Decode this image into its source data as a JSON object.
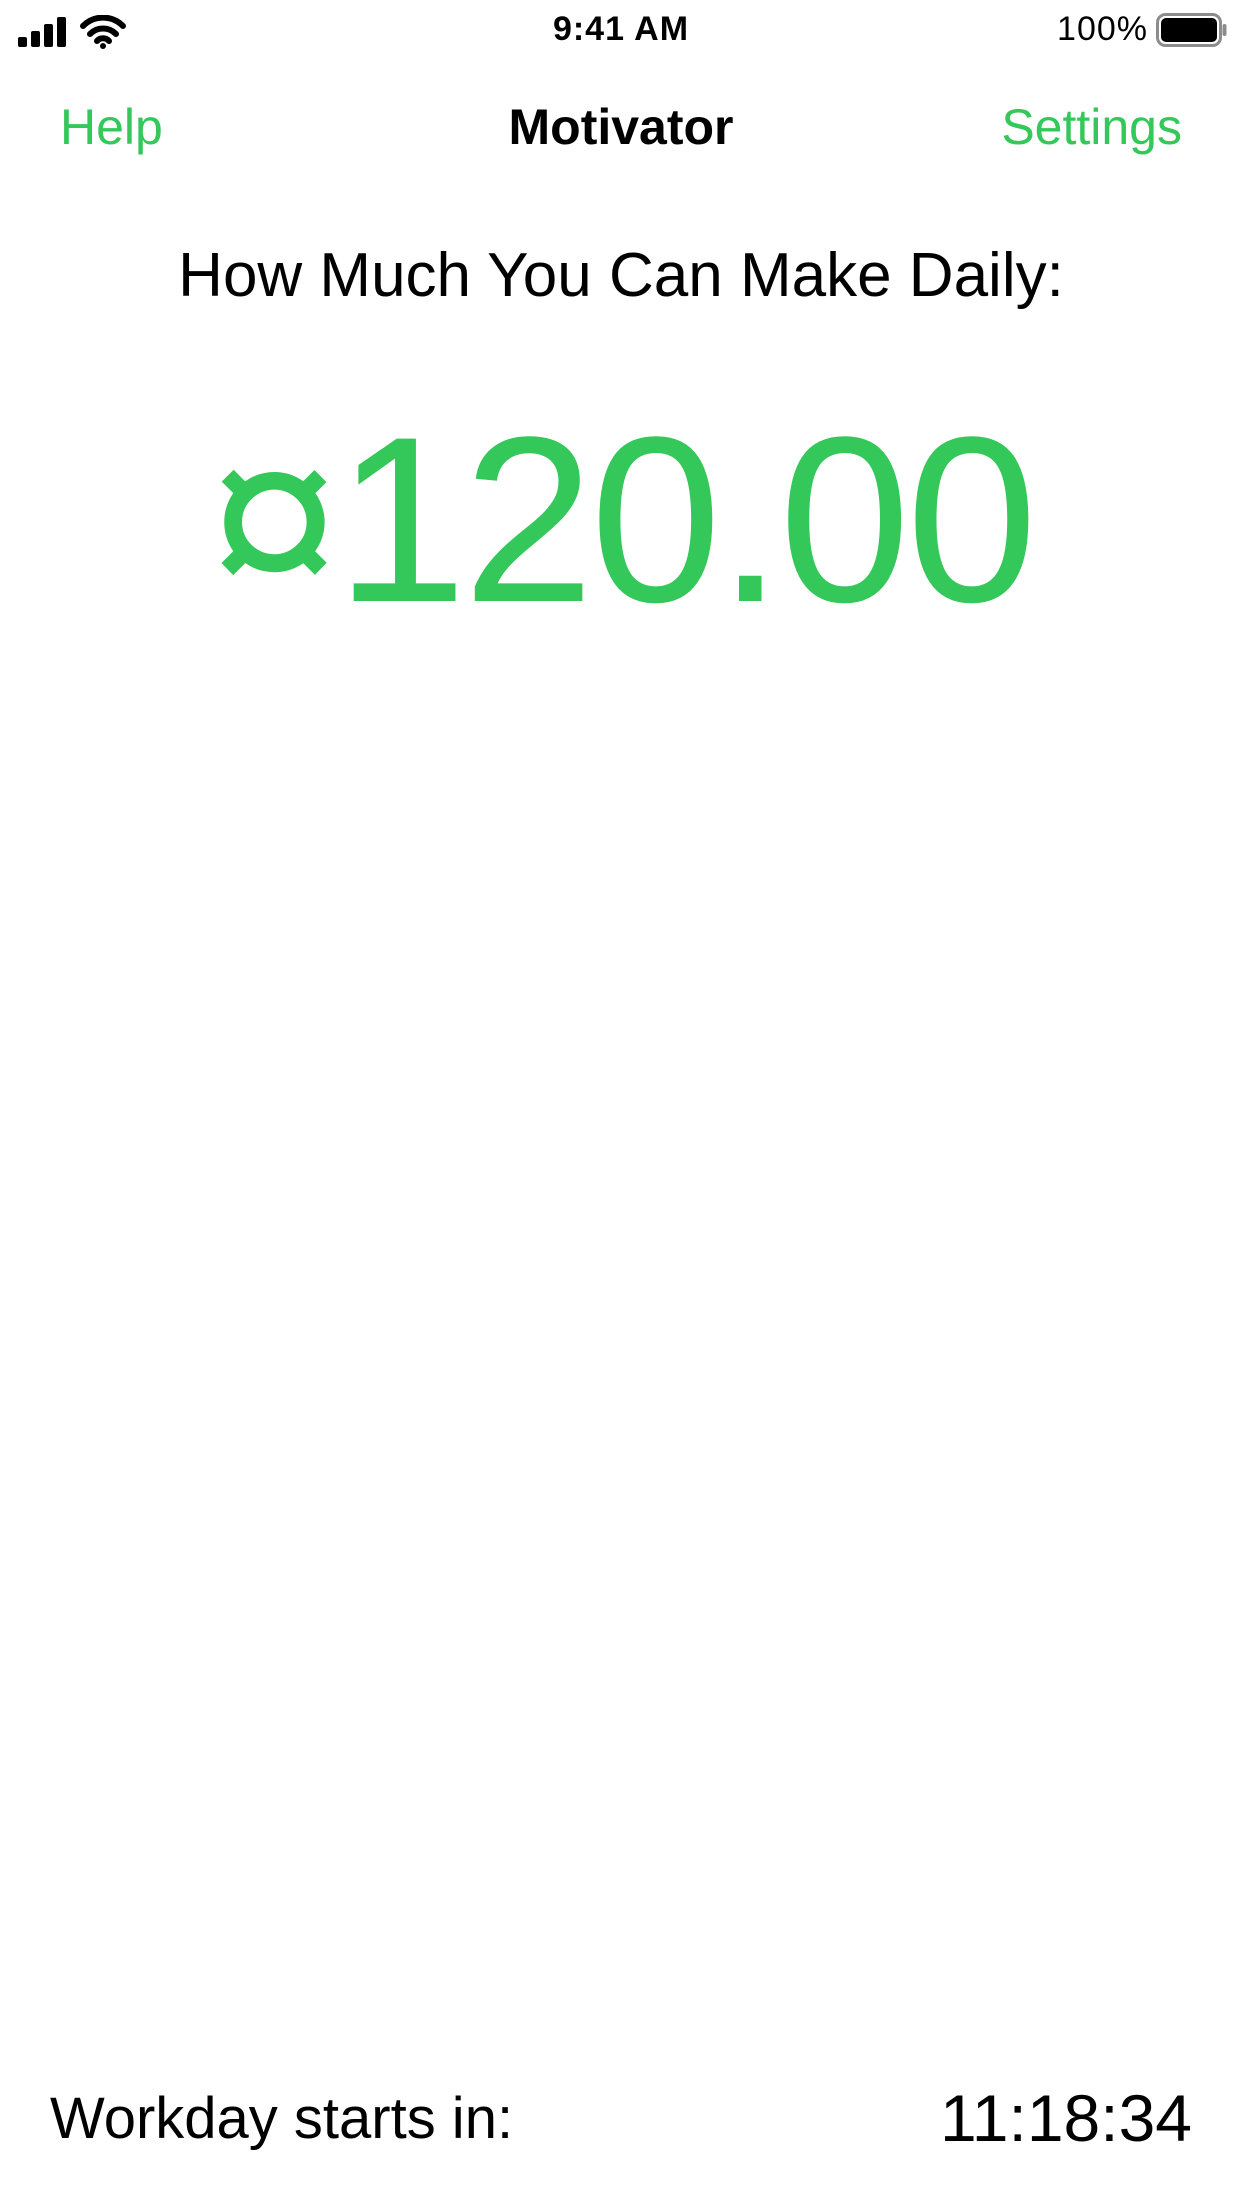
{
  "colors": {
    "accent": "#34C759",
    "text": "#000000",
    "background": "#FFFFFF"
  },
  "status_bar": {
    "time": "9:41 AM",
    "battery_percent": "100%",
    "icons": [
      "signal-icon",
      "wifi-icon",
      "battery-icon"
    ]
  },
  "nav": {
    "left_label": "Help",
    "title": "Motivator",
    "right_label": "Settings"
  },
  "main": {
    "headline": "How Much You Can Make Daily:",
    "amount": "¤120.00"
  },
  "footer": {
    "label": "Workday starts in:",
    "countdown": "11:18:34"
  }
}
